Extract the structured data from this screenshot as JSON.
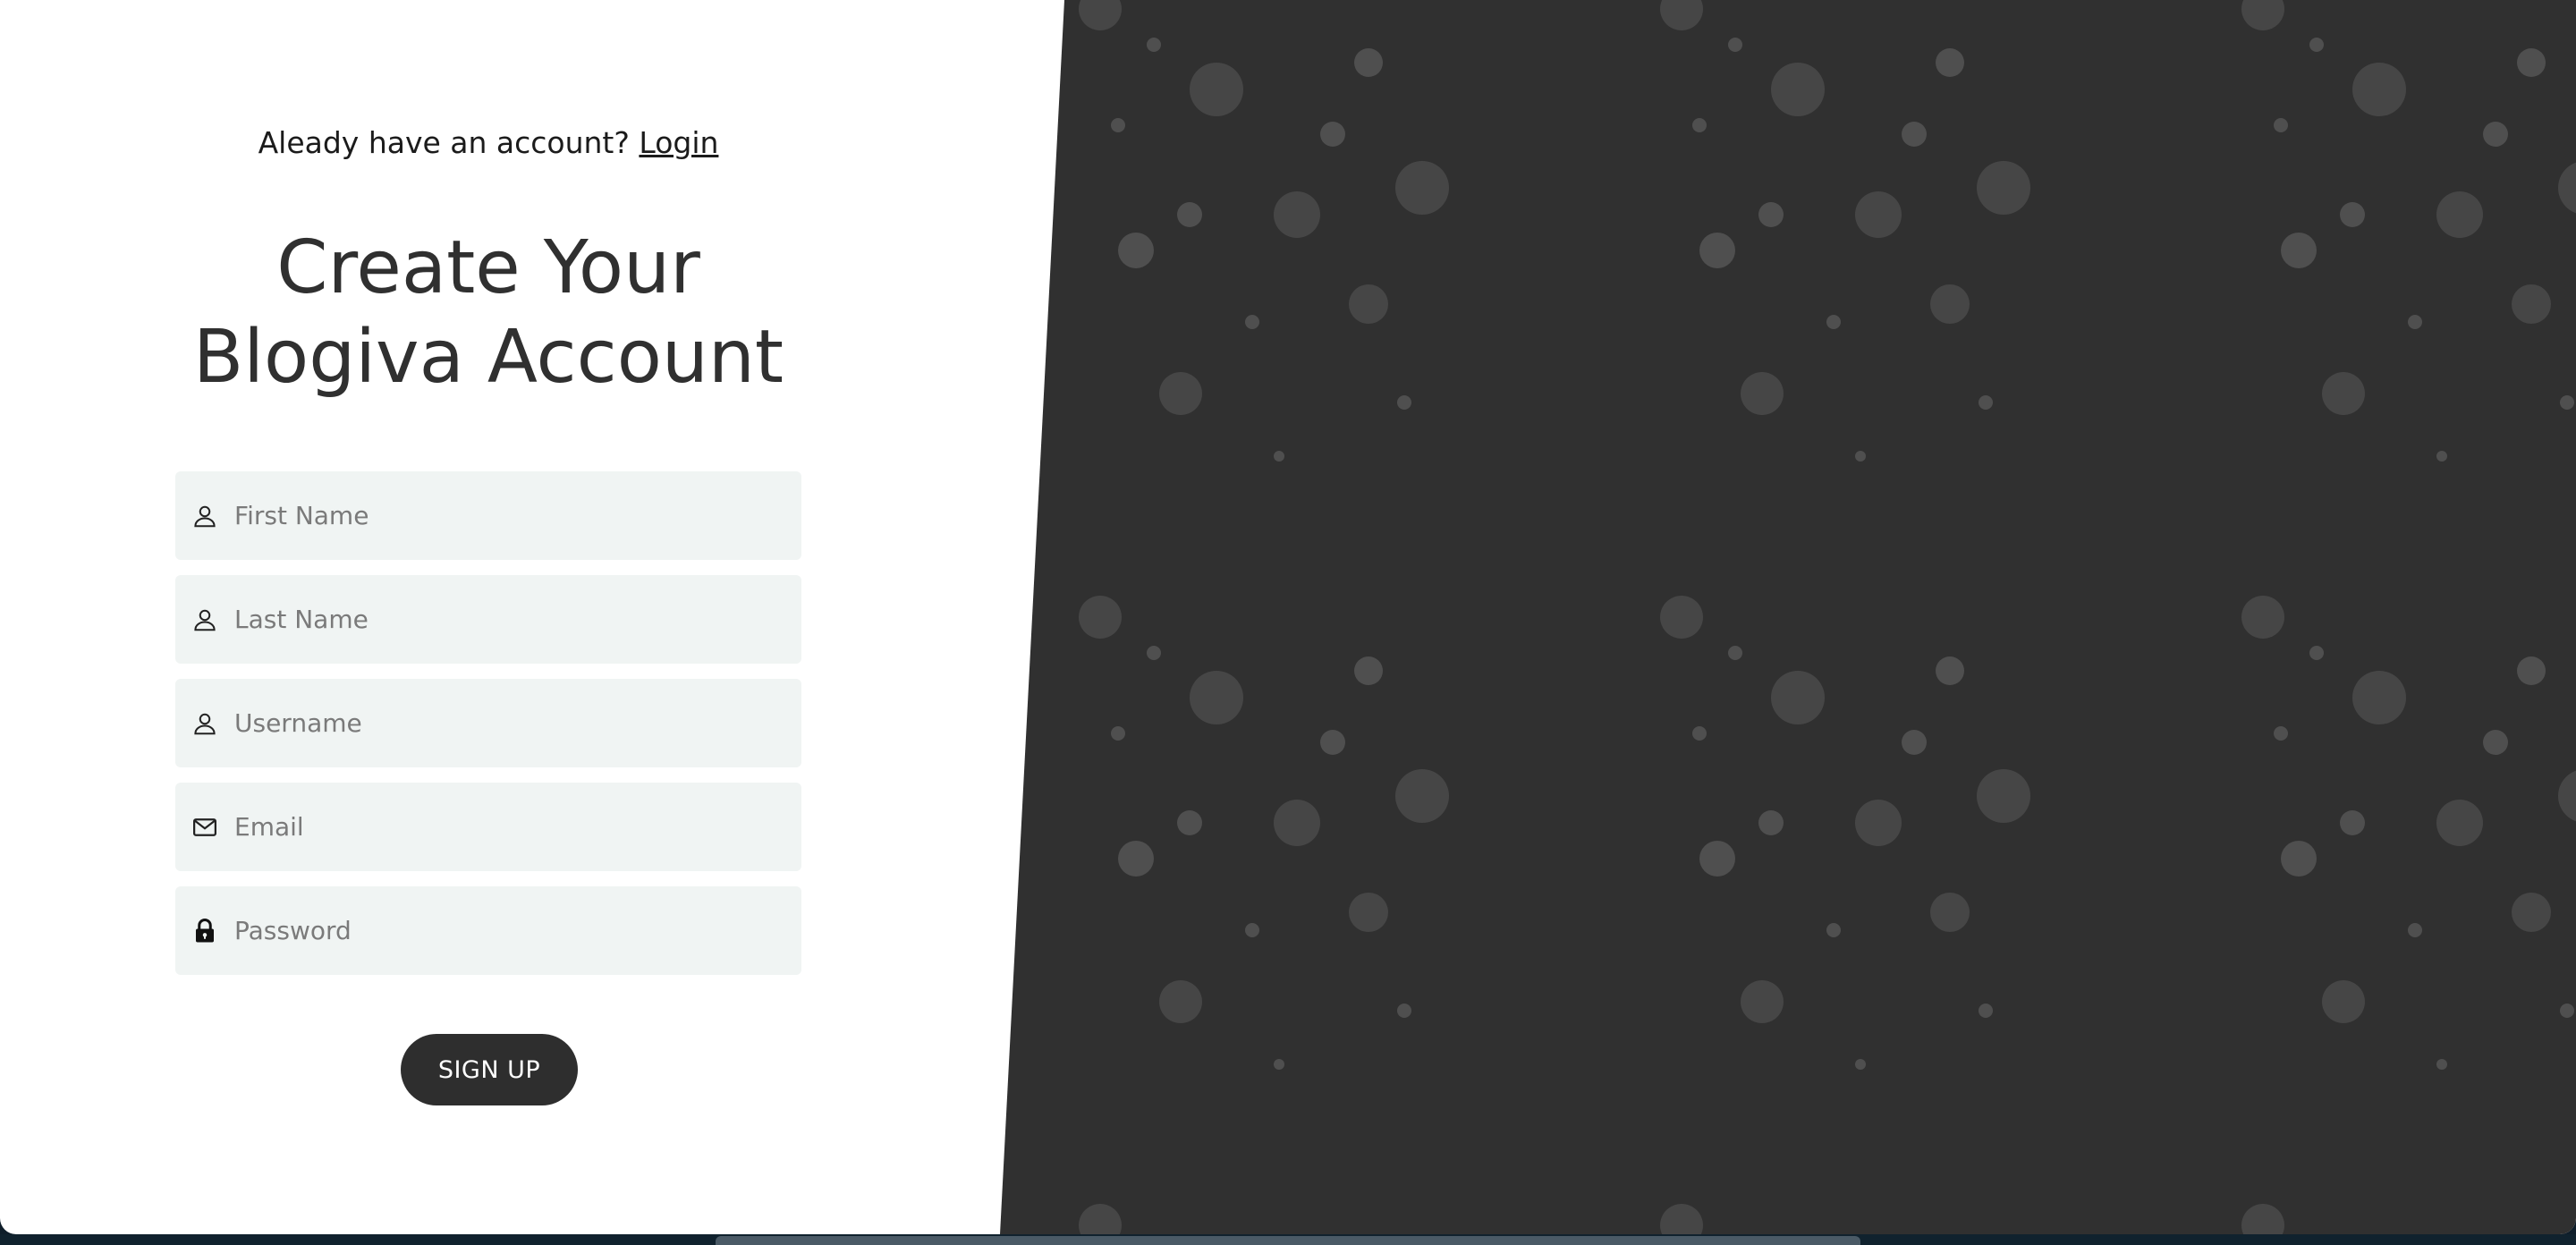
{
  "header": {
    "prompt_text": "Aleady have an account?",
    "login_link": "Login"
  },
  "title": {
    "line1": "Create Your",
    "line2": "Blogiva Account"
  },
  "form": {
    "first_name": {
      "placeholder": "First Name",
      "icon": "person-icon"
    },
    "last_name": {
      "placeholder": "Last Name",
      "icon": "person-icon"
    },
    "username": {
      "placeholder": "Username",
      "icon": "person-icon"
    },
    "email": {
      "placeholder": "Email",
      "icon": "envelope-icon"
    },
    "password": {
      "placeholder": "Password",
      "icon": "lock-icon"
    },
    "submit_label": "SIGN UP"
  },
  "colors": {
    "panel_dark": "#303030",
    "field_bg": "#f0f4f3",
    "button_bg": "#2e2e2e",
    "bubble": "#5a5a5a"
  }
}
